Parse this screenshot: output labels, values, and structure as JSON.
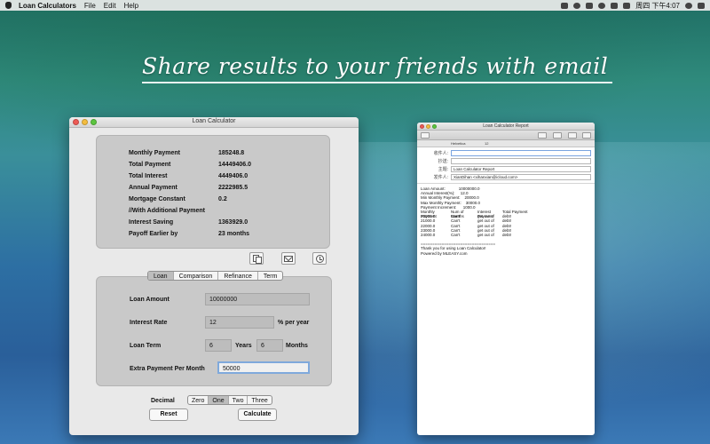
{
  "menubar": {
    "app_name": "Loan Calculators",
    "items": [
      "File",
      "Edit",
      "Help"
    ],
    "clock": "周四 下午4:07"
  },
  "headline": "Share results to your friends with email",
  "main_window": {
    "title": "Loan Calculator",
    "results": [
      {
        "label": "Monthly Payment",
        "value": "185248.8"
      },
      {
        "label": "Total Payment",
        "value": "14449406.0"
      },
      {
        "label": "Total Interest",
        "value": "4449406.0"
      },
      {
        "label": "Annual Payment",
        "value": "2222985.5"
      },
      {
        "label": "Mortgage Constant",
        "value": "0.2"
      },
      {
        "label": "//With Additional Payment",
        "value": ""
      },
      {
        "label": "Interest Saving",
        "value": "1363929.0"
      },
      {
        "label": "Payoff Earlier by",
        "value": "23 months"
      }
    ],
    "tabs": [
      "Loan",
      "Comparison",
      "Refinance",
      "Term"
    ],
    "active_tab": "Loan",
    "fields": {
      "loan_amount_label": "Loan Amount",
      "loan_amount": "10000000",
      "interest_rate_label": "Interest Rate",
      "interest_rate": "12",
      "interest_unit": "% per year",
      "loan_term_label": "Loan Term",
      "term_years": "6",
      "years_label": "Years",
      "term_months": "6",
      "months_label": "Months",
      "extra_label": "Extra Payment Per Month",
      "extra_value": "50000"
    },
    "decimal_label": "Decimal",
    "decimal_options": [
      "Zero",
      "One",
      "Two",
      "Three"
    ],
    "decimal_selected": "One",
    "reset_label": "Reset",
    "calculate_label": "Calculate"
  },
  "report_window": {
    "title": "Loan Calculator Report",
    "fmt_font": "Helvetica",
    "fmt_size": "12",
    "to_label": "收件人:",
    "cc_label": "抄送:",
    "subject_label": "主题:",
    "subject": "Loan Calculator Report",
    "from_label": "发件人:",
    "from_value": "XianDihan <xihanxian@icloud.com>",
    "body_lines": [
      "Loan Amount:            10000000.0",
      "Annual Interest(%):     12.0",
      "Min Monthly Payment:    20000.0",
      "Max Monthly Payment:    30000.0",
      "Payment Increment:      1000.0"
    ],
    "table_header": [
      "Monthly Payment",
      "Num of Months",
      "Interest Payment",
      "Total Payment"
    ],
    "table_rows": [
      [
        "20000.0",
        "Can't",
        "get out of",
        "debt!"
      ],
      [
        "21000.0",
        "Can't",
        "get out of",
        "debt!"
      ],
      [
        "22000.0",
        "Can't",
        "get out of",
        "debt!"
      ],
      [
        "23000.0",
        "Can't",
        "get out of",
        "debt!"
      ],
      [
        "24000.0",
        "Can't",
        "get out of",
        "debt!"
      ]
    ],
    "separator": "================================",
    "footer_lines": [
      "Thank you for using Loan Calculator!",
      "Powered by MLEASY.com"
    ]
  },
  "colors": {
    "accent_focus": "#7fa9dc",
    "close": "#ee5b55",
    "minimize": "#f4bd3f",
    "maximize": "#5cc63f"
  }
}
